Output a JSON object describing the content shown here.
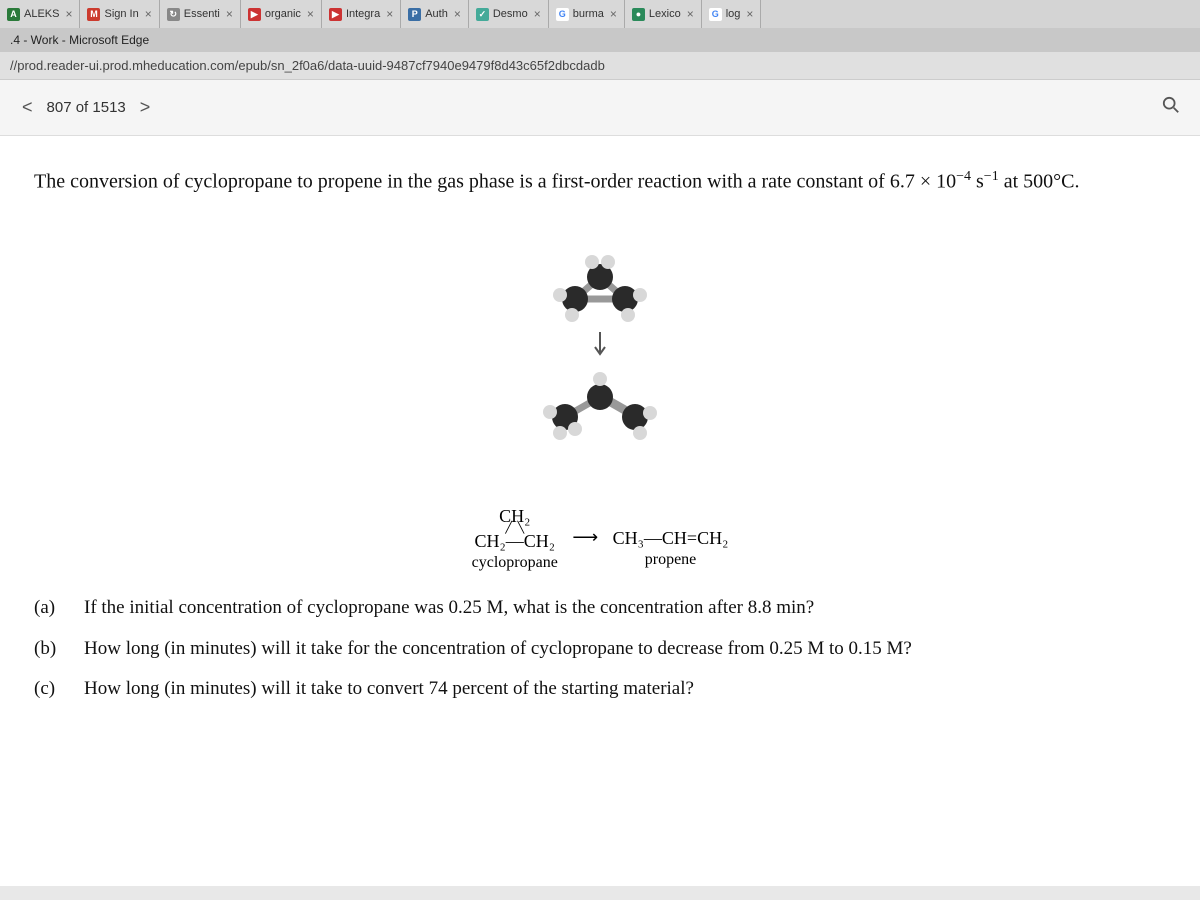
{
  "tabs": [
    {
      "label": "ALEKS",
      "icon_bg": "#2a7a3a",
      "icon_fg": "#fff",
      "icon_text": "A"
    },
    {
      "label": "Sign In",
      "icon_bg": "#cc3b2e",
      "icon_fg": "#fff",
      "icon_text": "M"
    },
    {
      "label": "Essenti",
      "icon_bg": "#888",
      "icon_fg": "#fff",
      "icon_text": "↻"
    },
    {
      "label": "organic",
      "icon_bg": "#cc3333",
      "icon_fg": "#fff",
      "icon_text": "▶"
    },
    {
      "label": "Integra",
      "icon_bg": "#cc3333",
      "icon_fg": "#fff",
      "icon_text": "▶"
    },
    {
      "label": "Auth",
      "icon_bg": "#3a6ea5",
      "icon_fg": "#fff",
      "icon_text": "P"
    },
    {
      "label": "Desmo",
      "icon_bg": "#4a9",
      "icon_fg": "#fff",
      "icon_text": "✓"
    },
    {
      "label": "burma",
      "icon_bg": "#fff",
      "icon_fg": "#4285f4",
      "icon_text": "G"
    },
    {
      "label": "Lexico",
      "icon_bg": "#2a8a5a",
      "icon_fg": "#fff",
      "icon_text": "●"
    },
    {
      "label": "log",
      "icon_bg": "#fff",
      "icon_fg": "#4285f4",
      "icon_text": "G"
    }
  ],
  "window_title": ".4 - Work - Microsoft Edge",
  "url": "//prod.reader-ui.prod.mheducation.com/epub/sn_2f0a6/data-uuid-9487cf7940e9479f8d43c65f2dbcdadb",
  "page_nav": {
    "current": "807",
    "total": "1513",
    "of": "of"
  },
  "problem": {
    "text_prefix": "The conversion of cyclopropane to propene in the gas phase is a first-order reaction with a rate constant of ",
    "rate_constant": "6.7 × 10",
    "rate_exp": "−4",
    "rate_unit_base": " s",
    "rate_unit_exp": "−1",
    "text_suffix": " at 500°C."
  },
  "equation": {
    "cyclo_top": "CH₂",
    "cyclo_bottom": "CH₂—CH₂",
    "cyclo_label": "cyclopropane",
    "arrow": "⟶",
    "propene_formula": "CH₃—CH=CH₂",
    "propene_label": "propene"
  },
  "questions": {
    "a": {
      "label": "(a)",
      "text": "If the initial concentration of cyclopropane was 0.25 M, what is the concentration after 8.8 min?"
    },
    "b": {
      "label": "(b)",
      "text": "How long (in minutes) will it take for the concentration of cyclopropane to decrease from 0.25 M to 0.15 M?"
    },
    "c": {
      "label": "(c)",
      "text": "How long (in minutes) will it take to convert 74 percent of the starting material?"
    }
  },
  "colors": {
    "carbon": "#2a2a2a",
    "hydrogen": "#d8d8d8",
    "bond": "#888"
  }
}
